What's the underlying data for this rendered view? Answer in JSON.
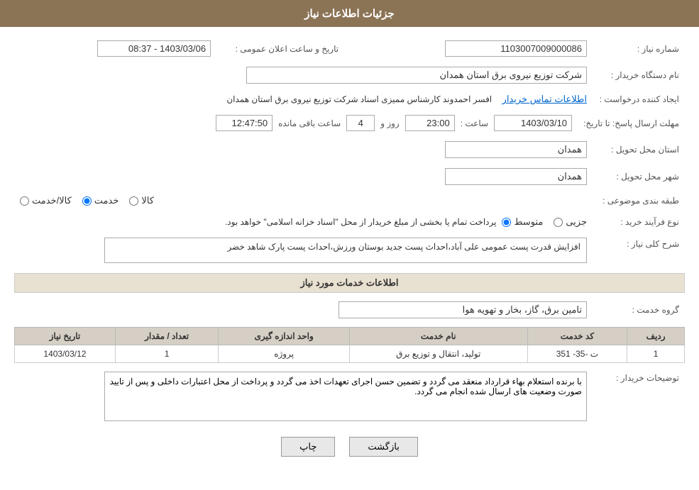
{
  "header": {
    "title": "جزئیات اطلاعات نیاز"
  },
  "fields": {
    "need_number_label": "شماره نیاز :",
    "need_number_value": "1103007009000086",
    "buyer_org_label": "نام دستگاه خریدار :",
    "buyer_org_value": "شرکت توزیع نیروی برق استان همدان",
    "creator_label": "ایجاد کننده درخواست :",
    "creator_value": "افسر احمدوند کارشناس ممیزی اسناد شرکت توزیع نیروی برق استان همدان",
    "creator_link": "اطلاعات تماس خریدار",
    "response_deadline_label": "مهلت ارسال پاسخ: تا تاریخ:",
    "deadline_date": "1403/03/10",
    "deadline_time_label": "ساعت :",
    "deadline_time": "23:00",
    "deadline_days_label": "روز و",
    "deadline_days": "4",
    "deadline_remaining_label": "ساعت باقی مانده",
    "deadline_remaining": "12:47:50",
    "announce_label": "تاریخ و ساعت اعلان عمومی :",
    "announce_value": "1403/03/06 - 08:37",
    "delivery_province_label": "استان محل تحویل :",
    "delivery_province_value": "همدان",
    "delivery_city_label": "شهر محل تحویل :",
    "delivery_city_value": "همدان",
    "category_label": "طبقه بندی موضوعی :",
    "category_options": [
      {
        "label": "کالا",
        "value": "kala"
      },
      {
        "label": "خدمت",
        "value": "khadamat"
      },
      {
        "label": "کالا/خدمت",
        "value": "kala_khadamat"
      }
    ],
    "category_selected": "khadamat",
    "purchase_type_label": "نوع فرآیند خرید :",
    "purchase_type_options": [
      {
        "label": "جزیی",
        "value": "jozei"
      },
      {
        "label": "متوسط",
        "value": "motavasset"
      }
    ],
    "purchase_type_selected": "motavasset",
    "purchase_note": "پرداخت تمام یا بخشی از مبلغ خریدار از محل \"اسناد خزانه اسلامی\" خواهد بود.",
    "need_description_label": "شرح کلی نیاز :",
    "need_description_value": "افزایش قدرت پست عمومی علی آباد،احداث پست جدید بوستان ورزش،احداث پست پارک شاهد خضر",
    "services_section_title": "اطلاعات خدمات مورد نیاز",
    "service_group_label": "گروه خدمت :",
    "service_group_value": "تامین برق، گاز، بخار و تهویه هوا",
    "table_headers": [
      "ردیف",
      "کد خدمت",
      "نام خدمت",
      "واحد اندازه گیری",
      "تعداد / مقدار",
      "تاریخ نیاز"
    ],
    "table_rows": [
      {
        "row": "1",
        "code": "ت -35- 351",
        "name": "تولید، انتقال و توزیع برق",
        "unit": "پروژه",
        "quantity": "1",
        "date": "1403/03/12"
      }
    ],
    "buyer_notes_label": "توضیحات خریدار :",
    "buyer_notes_value": "با برنده استعلام بهاء قرارداد منعقد می گردد و تضمین حسن اجرای تعهدات اخذ می گردد و پرداخت از محل اعتبارات داخلی و پس از تایید صورت وضعیت های ارسال شده انجام می گردد."
  },
  "buttons": {
    "print_label": "چاپ",
    "back_label": "بازگشت"
  }
}
